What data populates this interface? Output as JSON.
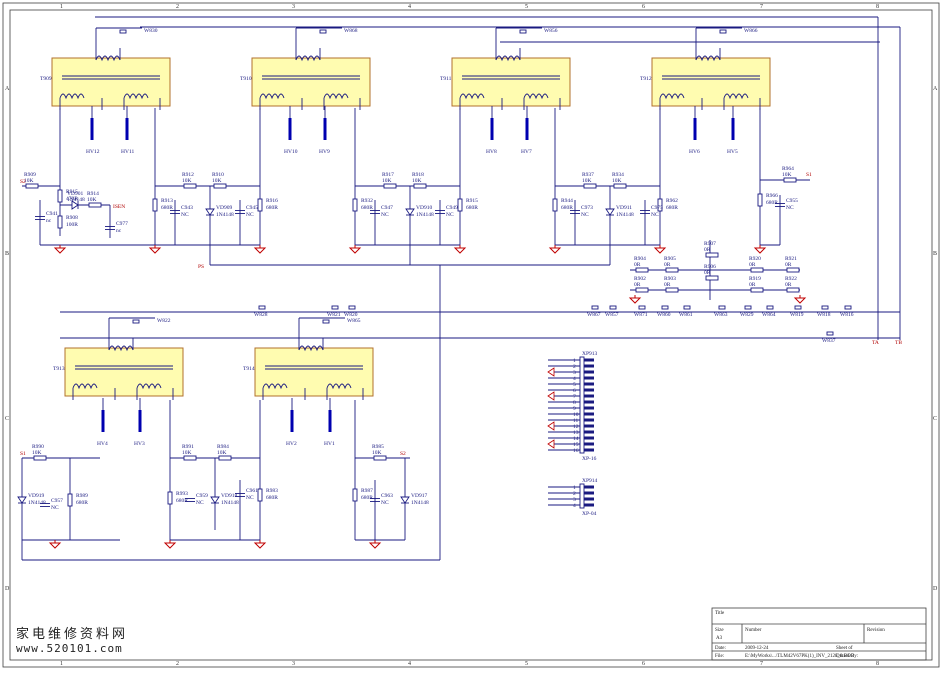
{
  "transformers": [
    {
      "ref": "T909",
      "jumper": "W830"
    },
    {
      "ref": "T910",
      "jumper": "W868"
    },
    {
      "ref": "T911",
      "jumper": "W856"
    },
    {
      "ref": "T912",
      "jumper": "W866"
    },
    {
      "ref": "T913",
      "jumper": "W822"
    },
    {
      "ref": "T914",
      "jumper": "W865"
    }
  ],
  "hv_outputs": [
    "HV12",
    "HV11",
    "HV10",
    "HV9",
    "HV8",
    "HV7",
    "HV6",
    "HV5",
    "HV4",
    "HV3",
    "HV2",
    "HV1"
  ],
  "nets": {
    "s2": "S2",
    "s1_top": "S1",
    "s1_bot": "S1",
    "s2_bot": "S2",
    "ps": "PS",
    "isen": "ISEN",
    "ta": "TA",
    "tb": "TB"
  },
  "parts_top": [
    {
      "ref": "R909",
      "val": "10K"
    },
    {
      "ref": "R915",
      "val": "470R"
    },
    {
      "ref": "VD901",
      "val": "1N4148"
    },
    {
      "ref": "R914",
      "val": "10K"
    },
    {
      "ref": "R908",
      "val": "100R"
    },
    {
      "ref": "C941",
      "val": "nc"
    },
    {
      "ref": "C977",
      "val": "nc"
    },
    {
      "ref": "R913",
      "val": "680R"
    },
    {
      "ref": "C943",
      "val": "NC"
    },
    {
      "ref": "R912",
      "val": "10K"
    },
    {
      "ref": "VD909",
      "val": "1N4148"
    },
    {
      "ref": "R910",
      "val": "10K"
    },
    {
      "ref": "C945",
      "val": "NC"
    },
    {
      "ref": "R916",
      "val": "680R"
    },
    {
      "ref": "R932",
      "val": "680R"
    },
    {
      "ref": "C947",
      "val": "NC"
    },
    {
      "ref": "R917",
      "val": "10K"
    },
    {
      "ref": "VD910",
      "val": "1N4148"
    },
    {
      "ref": "R918",
      "val": "10K"
    },
    {
      "ref": "C949",
      "val": "NC"
    },
    {
      "ref": "R915",
      "val": "680R"
    },
    {
      "ref": "R944",
      "val": "680R"
    },
    {
      "ref": "C973",
      "val": "NC"
    },
    {
      "ref": "R937",
      "val": "10K"
    },
    {
      "ref": "VD911",
      "val": "1N4148"
    },
    {
      "ref": "R934",
      "val": "10K"
    },
    {
      "ref": "C975",
      "val": "NC"
    },
    {
      "ref": "R962",
      "val": "680R"
    },
    {
      "ref": "R966",
      "val": "680R"
    },
    {
      "ref": "C955",
      "val": "NC"
    },
    {
      "ref": "R964",
      "val": "10K"
    }
  ],
  "zero_ohm": [
    {
      "ref": "R904",
      "val": "0R"
    },
    {
      "ref": "R905",
      "val": "0R"
    },
    {
      "ref": "R907",
      "val": "0R"
    },
    {
      "ref": "R920",
      "val": "0R"
    },
    {
      "ref": "R921",
      "val": "0R"
    },
    {
      "ref": "R902",
      "val": "0R"
    },
    {
      "ref": "R903",
      "val": "0R"
    },
    {
      "ref": "R906",
      "val": "0R"
    },
    {
      "ref": "R919",
      "val": "0R"
    },
    {
      "ref": "R922",
      "val": "0R"
    }
  ],
  "jumper_row": [
    "W867",
    "W857",
    "W871",
    "W860",
    "W861",
    "W863",
    "W829",
    "W864",
    "W819",
    "W818",
    "W816"
  ],
  "jumpers_mid": [
    "W828",
    "W821",
    "W820",
    "W837"
  ],
  "parts_bottom": [
    {
      "ref": "R990",
      "val": "10K"
    },
    {
      "ref": "VD919",
      "val": "1N4148"
    },
    {
      "ref": "C957",
      "val": "NC"
    },
    {
      "ref": "R989",
      "val": "680R"
    },
    {
      "ref": "R991",
      "val": "10K"
    },
    {
      "ref": "R993",
      "val": "680R"
    },
    {
      "ref": "C959",
      "val": "NC"
    },
    {
      "ref": "VD918",
      "val": "1N4148"
    },
    {
      "ref": "R984",
      "val": "10K"
    },
    {
      "ref": "C961",
      "val": "NC"
    },
    {
      "ref": "R983",
      "val": "680R"
    },
    {
      "ref": "R985",
      "val": "10K"
    },
    {
      "ref": "R987",
      "val": "680R"
    },
    {
      "ref": "C963",
      "val": "NC"
    },
    {
      "ref": "VD917",
      "val": "1N4148"
    }
  ],
  "connectors": [
    {
      "ref": "XP913",
      "part": "XP-16",
      "pins": [
        "1",
        "2",
        "3",
        "4",
        "5",
        "6",
        "7",
        "8",
        "9",
        "10",
        "11",
        "12",
        "13",
        "14",
        "15",
        "16"
      ]
    },
    {
      "ref": "XP914",
      "part": "XP-04",
      "pins": [
        "1",
        "2",
        "3",
        "4"
      ]
    }
  ],
  "grid": {
    "cols": [
      "1",
      "2",
      "3",
      "4",
      "5",
      "6",
      "7",
      "8"
    ],
    "rows": [
      "A",
      "B",
      "C",
      "D"
    ]
  },
  "title_block": {
    "title": "Title",
    "size_label": "Size",
    "size": "A3",
    "number_label": "Number",
    "revision_label": "Revision",
    "date_label": "Date:",
    "date": "2009-12-24",
    "sheet_label": "Sheet    of",
    "file_label": "File:",
    "file": "E:\\MyWorks\\...\\TLM42V67PK(1)_INV_2128_8.DDB",
    "drawn_label": "Drawn By:"
  },
  "watermark": {
    "cn": "家电维修资料网",
    "url": "www.520101.com"
  }
}
